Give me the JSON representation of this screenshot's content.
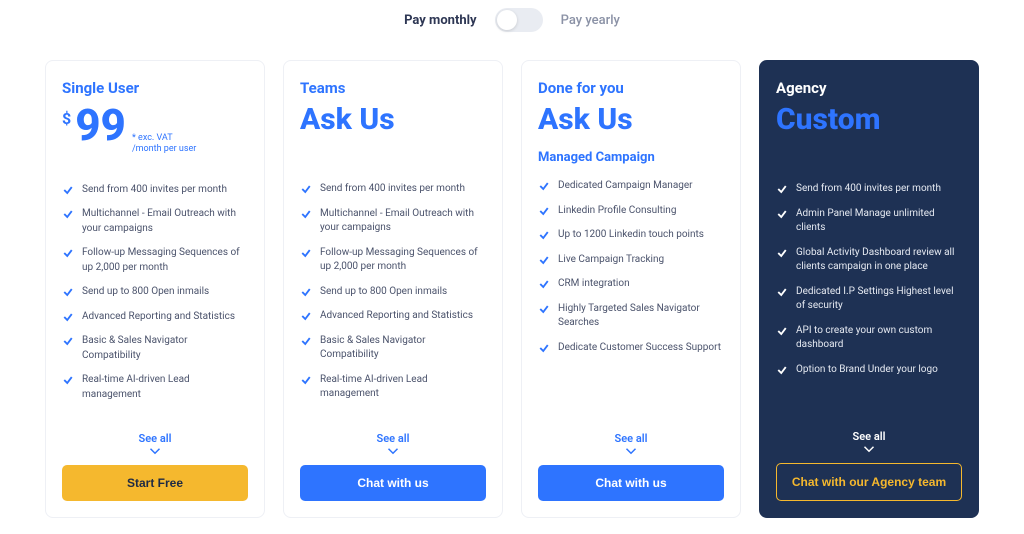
{
  "toggle": {
    "left": "Pay monthly",
    "right": "Pay yearly"
  },
  "plans": [
    {
      "name": "Single User",
      "price_number": "99",
      "currency": "$",
      "note1": "* exc. VAT",
      "note2": "/month per user",
      "subtitle": "",
      "features": [
        "Send from 400 invites per month",
        "Multichannel - Email Outreach with your campaigns",
        "Follow-up Messaging Sequences of up 2,000 per month",
        "Send up to 800 Open inmails",
        "Advanced Reporting and Statistics",
        "Basic & Sales Navigator Compatibility",
        "Real-time AI-driven Lead management"
      ],
      "see_all": "See all",
      "cta": "Start Free"
    },
    {
      "name": "Teams",
      "price_text": "Ask Us",
      "subtitle": "",
      "features": [
        "Send from 400 invites per month",
        "Multichannel - Email Outreach with your campaigns",
        "Follow-up Messaging Sequences of up 2,000 per month",
        "Send up to 800 Open inmails",
        "Advanced Reporting and Statistics",
        "Basic & Sales Navigator Compatibility",
        "Real-time AI-driven Lead management"
      ],
      "see_all": "See all",
      "cta": "Chat with us"
    },
    {
      "name": "Done for you",
      "price_text": "Ask Us",
      "subtitle": "Managed Campaign",
      "features": [
        "Dedicated Campaign Manager",
        "Linkedin Profile Consulting",
        "Up to 1200 Linkedin touch points",
        "Live Campaign Tracking",
        "CRM integration",
        "Highly Targeted Sales Navigator Searches",
        "Dedicate Customer Success Support"
      ],
      "see_all": "See all",
      "cta": "Chat with us"
    },
    {
      "name": "Agency",
      "price_text": "Custom",
      "subtitle": "",
      "features": [
        "Send from 400 invites per month",
        "Admin Panel Manage unlimited clients",
        "Global Activity Dashboard review all clients campaign in one place",
        "Dedicated I.P Settings Highest level of security",
        "API to create your own custom dashboard",
        "Option to Brand Under your logo"
      ],
      "see_all": "See all",
      "cta": "Chat with our Agency team"
    }
  ]
}
